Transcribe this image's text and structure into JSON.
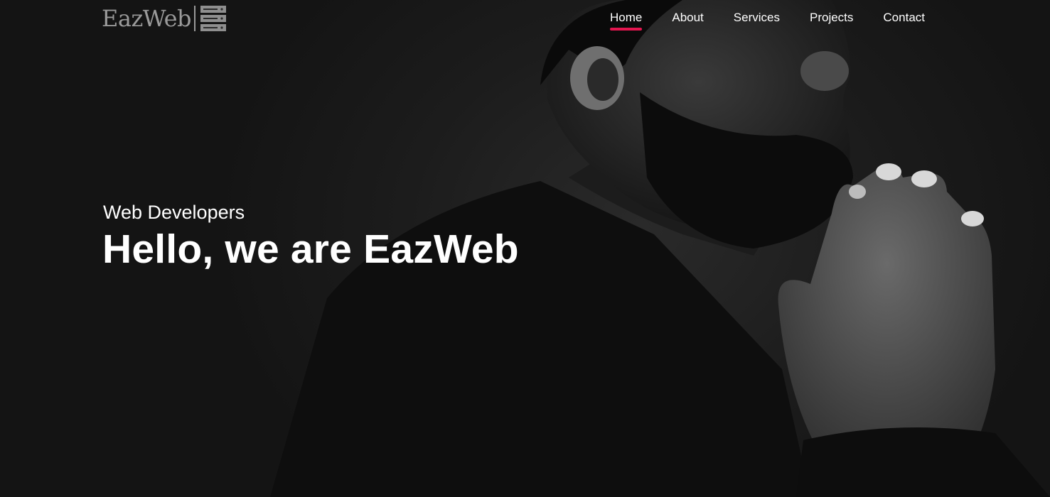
{
  "brand": {
    "name": "EazWeb",
    "icon": "server-rack-icon",
    "color": "#9a9a9a"
  },
  "nav": {
    "items": [
      {
        "label": "Home",
        "active": true
      },
      {
        "label": "About",
        "active": false
      },
      {
        "label": "Services",
        "active": false
      },
      {
        "label": "Projects",
        "active": false
      },
      {
        "label": "Contact",
        "active": false
      }
    ],
    "accent": "#e3154f"
  },
  "hero": {
    "subtitle": "Web Developers",
    "headline": "Hello, we are EazWeb",
    "image": "man-praying-photo"
  }
}
